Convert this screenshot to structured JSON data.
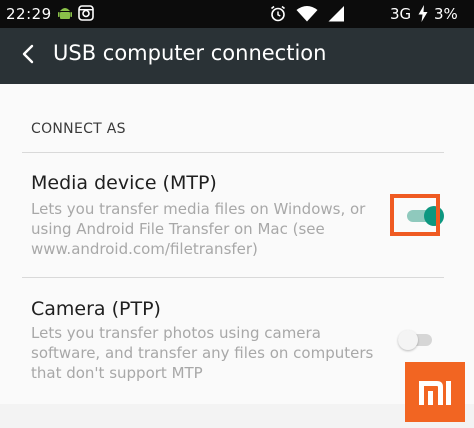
{
  "status_bar": {
    "time": "22:29",
    "network": "3G",
    "battery": "3%"
  },
  "app_bar": {
    "title": "USB computer connection"
  },
  "section": {
    "header": "CONNECT AS"
  },
  "options": [
    {
      "title": "Media device (MTP)",
      "description": "Lets you transfer media files on Windows, or using Android File Transfer on Mac (see www.android.com/filetransfer)",
      "enabled": true
    },
    {
      "title": "Camera (PTP)",
      "description": "Lets you transfer photos using camera software, and transfer any files on computers that don't support MTP",
      "enabled": false
    }
  ],
  "colors": {
    "app_bar": "#2a3236",
    "accent_toggle": "#0d9780",
    "highlight": "#ef5a22",
    "mi_logo": "#f26522"
  },
  "icons": {
    "status_left": [
      "android-icon",
      "instagram-icon"
    ],
    "status_right": [
      "alarm-icon",
      "wifi-icon",
      "charging-bolt-icon"
    ],
    "app_bar_left": "back-arrow-icon",
    "watermark": "mi-logo-icon"
  }
}
